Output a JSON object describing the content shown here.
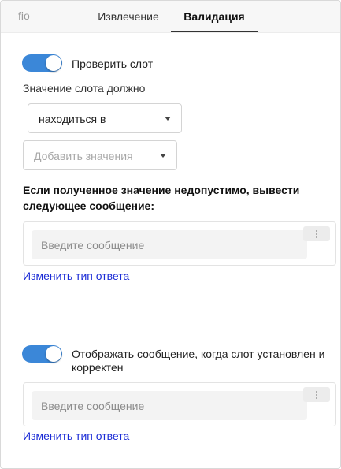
{
  "header": {
    "slot_name": "fio",
    "tabs": [
      {
        "label": "Извлечение",
        "active": false
      },
      {
        "label": "Валидация",
        "active": true
      }
    ]
  },
  "check_slot": {
    "toggle_on": true,
    "label": "Проверить слот"
  },
  "slot_value_label": "Значение слота должно",
  "condition_select": {
    "value": "находиться в"
  },
  "values_select": {
    "placeholder": "Добавить значения"
  },
  "invalid_heading": "Если полученное значение недопустимо, вывести следующее сообщение:",
  "invalid_message": {
    "placeholder": "Введите сообщение",
    "value": ""
  },
  "change_response_type_1": "Изменить тип ответа",
  "show_on_valid": {
    "toggle_on": true,
    "label": "Отображать сообщение, когда слот установлен и корректен"
  },
  "valid_message": {
    "placeholder": "Введите сообщение",
    "value": ""
  },
  "change_response_type_2": "Изменить тип ответа",
  "colors": {
    "toggle_on": "#3b87d8",
    "link": "#1a2bd6"
  }
}
